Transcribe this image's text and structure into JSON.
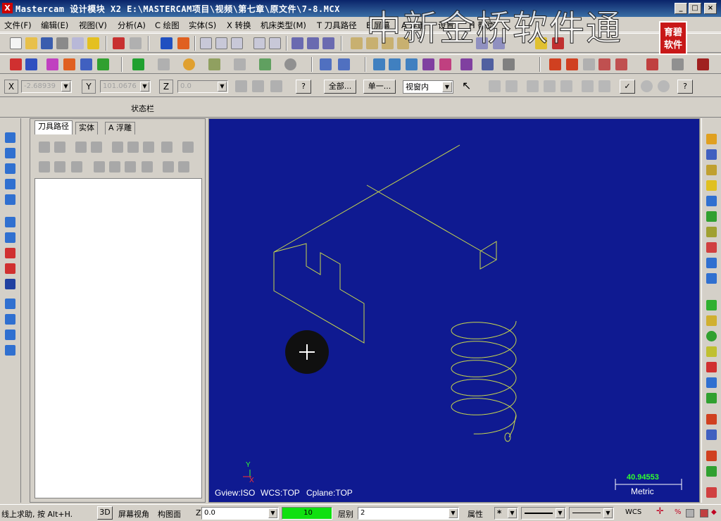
{
  "window": {
    "title": "Mastercam 设计模块  X2  E:\\MASTERCAM项目\\视频\\第七章\\原文件\\7-8.MCX",
    "app_icon": "X",
    "buttons": [
      "_",
      "□",
      "×"
    ]
  },
  "watermark": {
    "text": "中新金桥软件通",
    "logo_text": "育碧软件"
  },
  "menubar": {
    "items": [
      "文件(F)",
      "编辑(E)",
      "视图(V)",
      "分析(A)",
      "C 绘图",
      "实体(S)",
      "X 转换",
      "机床类型(M)",
      "T 刀具路径",
      "E 屏幕",
      "A 浮雕",
      "设置",
      "H 帮助"
    ]
  },
  "coordbar": {
    "x_label": "X",
    "x_value": "-2.68939",
    "y_label": "Y",
    "y_value": "101.0676",
    "z_label": "Z",
    "z_value": "0.0",
    "all_button": "全部...",
    "single_button": "单一...",
    "view_select": "视窗内",
    "help_icon": "?"
  },
  "statusrow": {
    "label": "状态栏"
  },
  "manager": {
    "tabs": [
      "刀具路径",
      "实体",
      "A 浮雕"
    ]
  },
  "viewport": {
    "background": "#0f1a91",
    "geometry_color": "#c9d84c",
    "axis_y_label": "Y",
    "axis_x_label": "X",
    "gview": "Gview:ISO",
    "wcs": "WCS:TOP",
    "cplane": "Cplane:TOP",
    "scale_value": "40.94553",
    "scale_unit": "Metric"
  },
  "bottombar": {
    "hint": "线上求助, 按 Alt+H.",
    "mode_3d": "3D",
    "screen_view": "屏幕视角",
    "construct_plane": "构图面",
    "z_label": "Z",
    "z_value": "0.0",
    "color_value": "10",
    "level_label": "层别",
    "level_value": "2",
    "attribute_label": "属性",
    "wcs_label": "WCS"
  }
}
